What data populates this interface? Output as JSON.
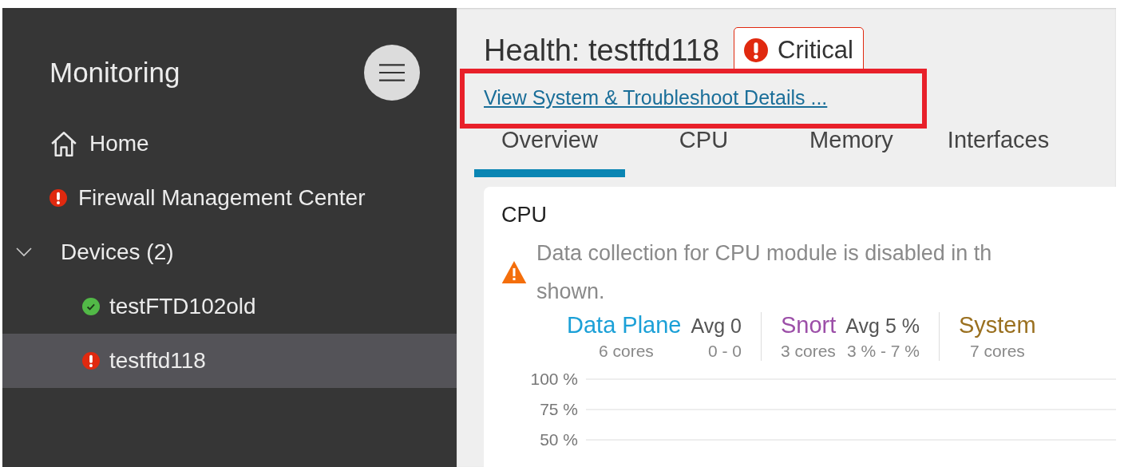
{
  "sidebar": {
    "title": "Monitoring",
    "items": [
      {
        "label": "Home",
        "kind": "home",
        "selected": false
      },
      {
        "label": "Firewall Management Center",
        "kind": "status",
        "alert": true,
        "selected": false
      },
      {
        "label": "Devices (2)",
        "kind": "group",
        "expanded": true,
        "selected": false,
        "children": [
          {
            "label": "testFTD102old",
            "alert": false,
            "selected": false
          },
          {
            "label": "testftd118",
            "alert": true,
            "selected": true
          }
        ]
      }
    ]
  },
  "header": {
    "title": "Health: testftd118",
    "badge": {
      "label": "Critical",
      "alert": true
    },
    "link": {
      "label": "View System & Troubleshoot Details ...",
      "highlighted": true
    }
  },
  "tabs": [
    {
      "label": "Overview",
      "selected": true
    },
    {
      "label": "CPU",
      "selected": false
    },
    {
      "label": "Memory",
      "selected": false
    },
    {
      "label": "Interfaces",
      "selected": false
    }
  ],
  "cpu_card": {
    "title": "CPU",
    "warning_lines": [
      "Data collection for CPU module is disabled in th",
      "shown."
    ],
    "legend": [
      {
        "name": "Data Plane",
        "color": "#1ba0d7",
        "avg": "Avg 0",
        "cores": "6 cores",
        "range": "0 - 0"
      },
      {
        "name": "Snort",
        "color": "#9c4fa8",
        "avg": "Avg 5 %",
        "cores": "3 cores",
        "range": "3 % - 7 %"
      },
      {
        "name": "System",
        "color": "#9a7020",
        "cores": "7 cores"
      }
    ],
    "y_labels": [
      "100 %",
      "75 %",
      "50 %"
    ]
  }
}
